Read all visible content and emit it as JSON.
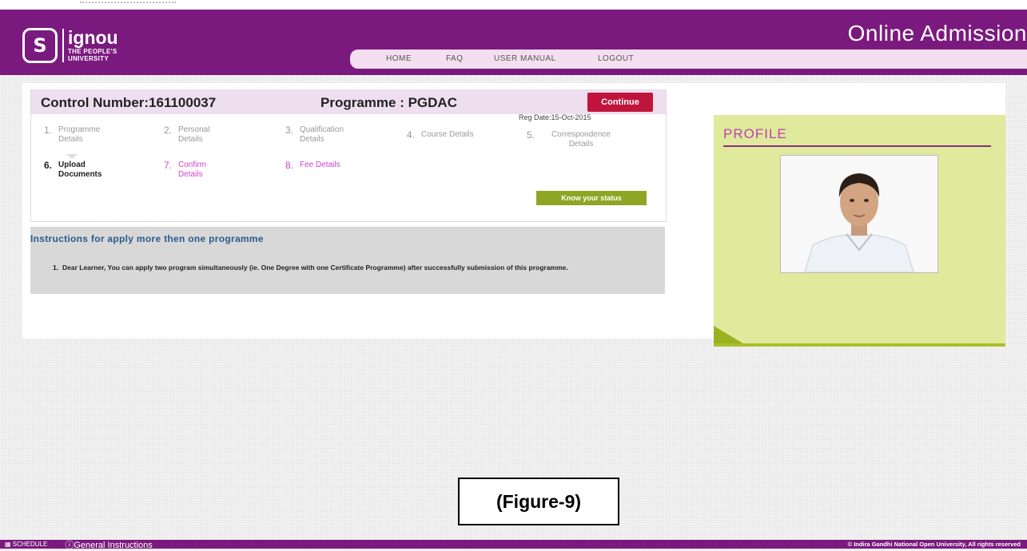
{
  "header": {
    "logo_title": "ignou",
    "logo_sub1": "THE PEOPLE'S",
    "logo_sub2": "UNIVERSITY",
    "app_title": "Online Admission",
    "nav": [
      "HOME",
      "FAQ",
      "USER MANUAL",
      "LOGOUT"
    ]
  },
  "card": {
    "control_number": "Control Number:161100037",
    "programme": "Programme :  PGDAC",
    "continue_label": "Continue",
    "reg_date": "Reg Date:15-Oct-2015",
    "know_status_label": "Know your status",
    "steps": [
      {
        "num": "1.",
        "label": "Programme Details"
      },
      {
        "num": "2.",
        "label": "Personal Details"
      },
      {
        "num": "3.",
        "label": "Qualification Details"
      },
      {
        "num": "4.",
        "label": "Course Details"
      },
      {
        "num": "5.",
        "label": "Correspondence Details"
      },
      {
        "num": "6.",
        "label": "Upload Documents"
      },
      {
        "num": "7.",
        "label": "Confirm Details"
      },
      {
        "num": "8.",
        "label": "Fee Details"
      }
    ]
  },
  "instructions": {
    "title": "Instructions for apply more then one programme",
    "item_num": "1.",
    "item_text": "Dear Learner, You can apply two program simultaneously (ie. One Degree with one Certificate Programme) after successfully submission of this programme."
  },
  "profile": {
    "title": "PROFILE"
  },
  "figure_caption": "(Figure-9)",
  "footer": {
    "schedule": "SCHEDULE",
    "general": "General Instructions",
    "copyright": "© Indira Gandhi National Open University, All rights reserved"
  },
  "colors": {
    "brand_purple": "#7b1a7e",
    "continue_red": "#c0143c",
    "status_green": "#8fa524",
    "profile_bg": "#dfea9c"
  }
}
